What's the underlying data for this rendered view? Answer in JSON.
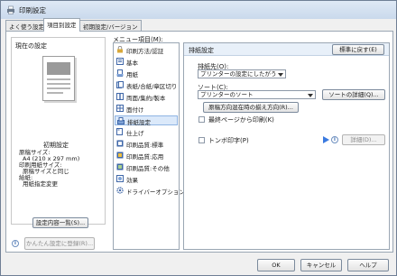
{
  "window": {
    "title": "印刷設定"
  },
  "tabs": [
    {
      "label": "よく使う設定"
    },
    {
      "label": "項目別設定"
    },
    {
      "label": "初期設定/バージョン"
    }
  ],
  "current_settings": {
    "heading": "現在の設定",
    "preset_name": "初期設定",
    "summary_lines": [
      "原稿サイズ:",
      "A4 (210 x 297 mm)",
      "印刷用紙サイズ:",
      "原稿サイズと同じ",
      "給紙:",
      "用紙指定変更"
    ],
    "list_button": "設定内容一覧(S)...",
    "register_button": "かんたん設定に登録(R)..."
  },
  "menu": {
    "label": "メニュー項目(M):",
    "items": [
      {
        "label": "印刷方法/認証",
        "icon": "lock-icon"
      },
      {
        "label": "基本",
        "icon": "basic-settings-icon"
      },
      {
        "label": "用紙",
        "icon": "paper-icon"
      },
      {
        "label": "表紙/合紙/章区切り",
        "icon": "cover-icon"
      },
      {
        "label": "両面/集約/製本",
        "icon": "duplex-icon"
      },
      {
        "label": "面付け",
        "icon": "imposition-icon"
      },
      {
        "label": "排紙設定",
        "icon": "output-tray-icon",
        "selected": true
      },
      {
        "label": "仕上げ",
        "icon": "finishing-icon"
      },
      {
        "label": "印刷品質:標準",
        "icon": "quality-standard-icon"
      },
      {
        "label": "印刷品質:応用",
        "icon": "quality-advanced-icon"
      },
      {
        "label": "印刷品質:その他",
        "icon": "quality-other-icon"
      },
      {
        "label": "効果",
        "icon": "effect-icon"
      },
      {
        "label": "ドライバーオプション",
        "icon": "gear-icon"
      }
    ]
  },
  "output_settings": {
    "section_title": "排紙設定",
    "reset_button": "標準に戻す(E)",
    "destination_label": "排紙先(O):",
    "destination_value": "プリンターの設定にしたがう",
    "sort_label": "ソート(C):",
    "sort_value": "プリンターのソート",
    "sort_detail_button": "ソートの詳細(Q)...",
    "rotate_button": "原稿方向混在時の揃え方向(R)...",
    "last_page_checkbox": "最終ページから印刷(K)",
    "last_page_checked": false,
    "banner_checkbox": "トンボ印字(P)",
    "banner_checked": false,
    "detail_button": "詳細(D)..."
  },
  "dialog_buttons": {
    "ok": "OK",
    "cancel": "キャンセル",
    "help": "ヘルプ"
  }
}
